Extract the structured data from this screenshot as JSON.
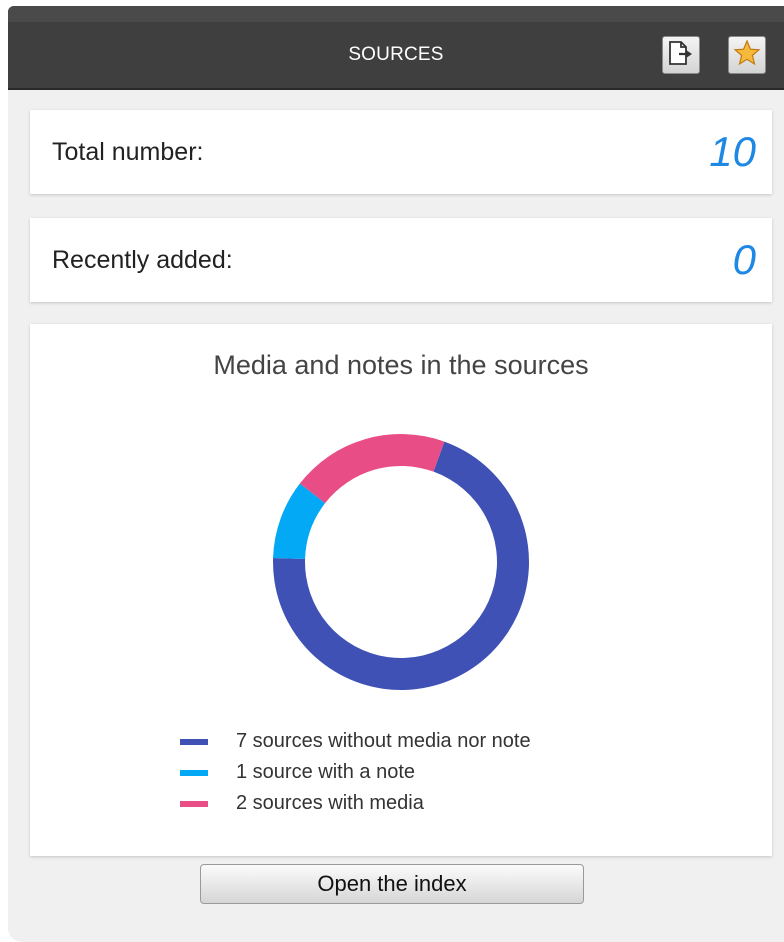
{
  "header": {
    "title": "SOURCES",
    "export_icon": "export-icon",
    "favorite_icon": "star-icon"
  },
  "stats": {
    "total_label": "Total number:",
    "total_value": "10",
    "recent_label": "Recently added:",
    "recent_value": "0"
  },
  "chart": {
    "title": "Media and notes in the sources"
  },
  "chart_data": {
    "type": "pie",
    "title": "Media and notes in the sources",
    "categories": [
      "7 sources without media nor note",
      "1 source with a note",
      "2 sources with media"
    ],
    "values": [
      7,
      1,
      2
    ],
    "colors": [
      "#3f51b5",
      "#03a9f4",
      "#e84d86"
    ],
    "legend": "bottom"
  },
  "actions": {
    "open_index_label": "Open the index"
  },
  "colors": {
    "value_accent": "#1e88e5",
    "titlebar": "#3f3f3f"
  }
}
